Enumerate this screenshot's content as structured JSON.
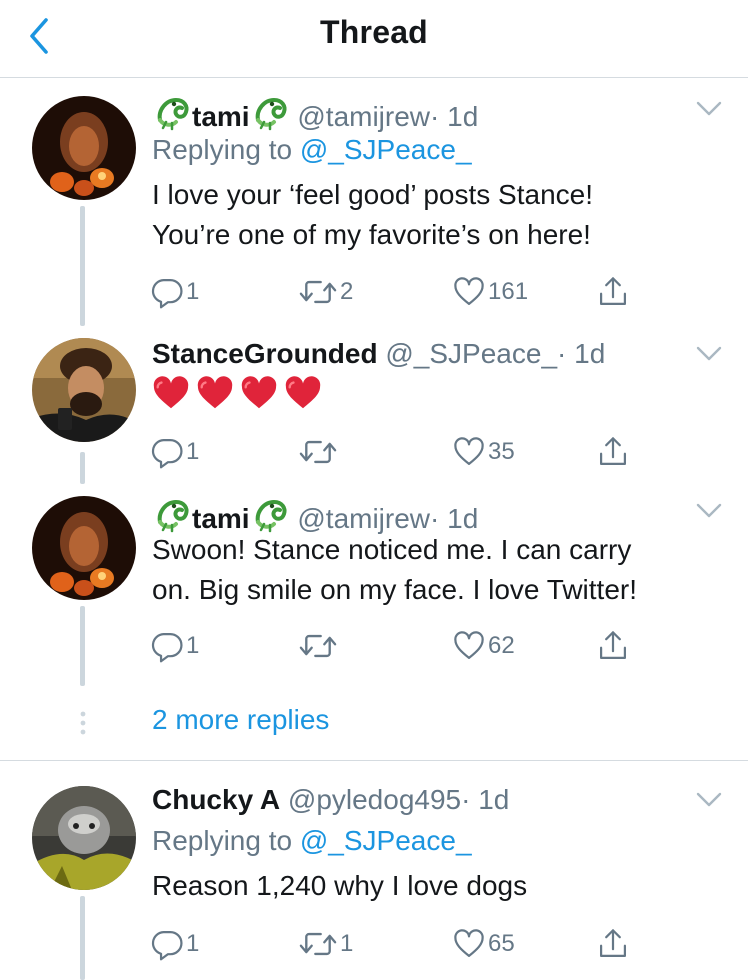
{
  "header": {
    "title": "Thread"
  },
  "tweets": [
    {
      "display_name": "tami",
      "handle": "@tamijrew",
      "time": "· 1d",
      "replying_label": "Replying to",
      "replying_to": "@_SJPeace_",
      "text_lines": [
        "I love your ‘feel good’ posts Stance!",
        "You’re one of my favorite’s on here!"
      ],
      "replies": "1",
      "retweets": "2",
      "likes": "161"
    },
    {
      "display_name": "StanceGrounded",
      "handle": "@_SJPeace_",
      "time": "· 1d",
      "text_lines": [
        "❤️❤️❤️❤️"
      ],
      "replies": "1",
      "retweets": "",
      "likes": "35"
    },
    {
      "display_name": "tami",
      "handle": "@tamijrew",
      "time": "· 1d",
      "text_lines": [
        "Swoon! Stance noticed me. I can carry",
        "on. Big smile on my face. I love Twitter!"
      ],
      "replies": "1",
      "retweets": "",
      "likes": "62"
    },
    {
      "display_name": "Chucky A",
      "handle": "@pyledog495",
      "time": "· 1d",
      "replying_label": "Replying to",
      "replying_to": "@_SJPeace_",
      "text_lines": [
        "Reason 1,240 why I love dogs"
      ],
      "replies": "1",
      "retweets": "1",
      "likes": "65"
    }
  ],
  "more_replies": "2 more replies",
  "colors": {
    "link": "#1b95e0",
    "secondary": "#657786",
    "text": "#14171a",
    "thread_line": "#ccd6dd",
    "heart": "#e0245e"
  },
  "icons": [
    "back-chevron-icon",
    "reply-icon",
    "retweet-icon",
    "like-icon",
    "share-icon",
    "caret-down-icon",
    "lizard-emoji-icon"
  ]
}
